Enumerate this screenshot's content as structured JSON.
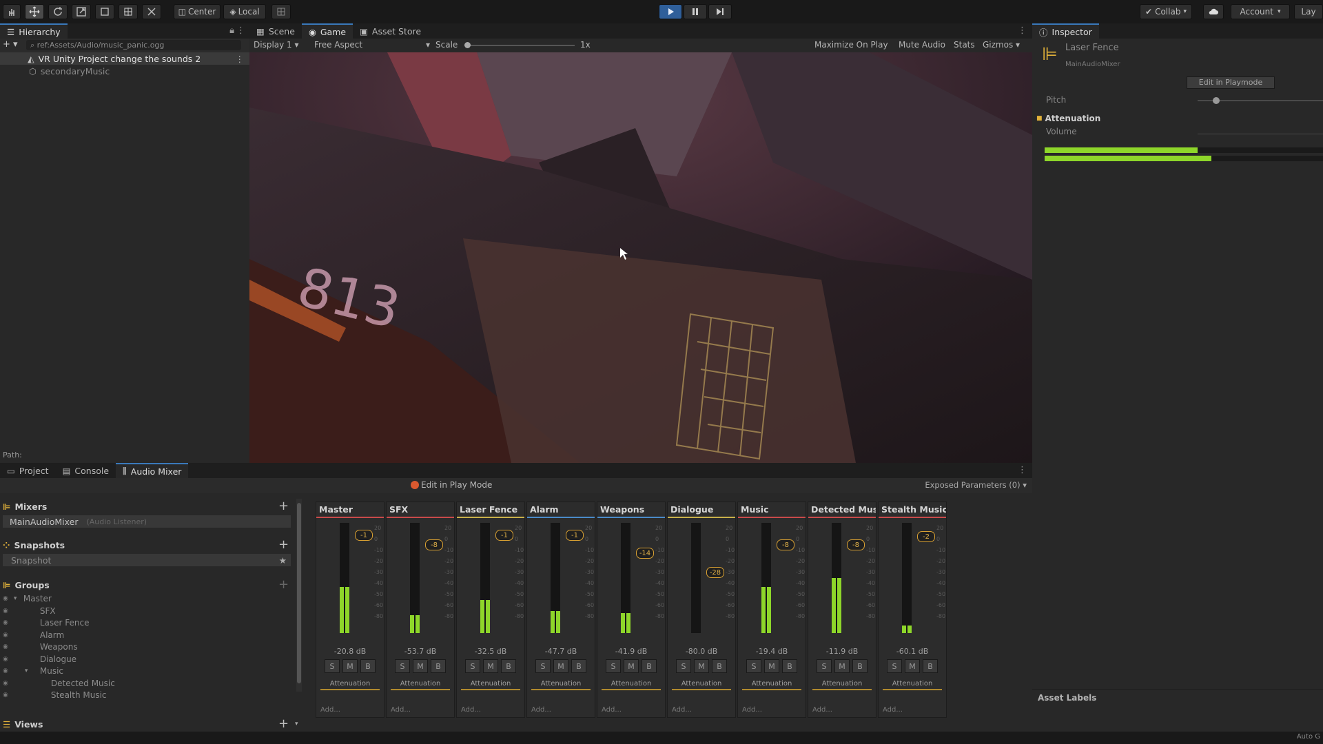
{
  "toolbar": {
    "pivot": "Center",
    "space": "Local",
    "collab": "Collab",
    "account": "Account",
    "layers": "Lay"
  },
  "hierarchy": {
    "tab": "Hierarchy",
    "search_path": "ref:Assets/Audio/music_panic.ogg",
    "scene_item": "VR Unity Project change the sounds 2",
    "child_item": "secondaryMusic",
    "path_label": "Path:"
  },
  "center_tabs": {
    "scene": "Scene",
    "game": "Game",
    "asset_store": "Asset Store"
  },
  "game_bar": {
    "display": "Display 1",
    "aspect": "Free Aspect",
    "scale_label": "Scale",
    "scale_value": "1x",
    "maximize": "Maximize On Play",
    "mute": "Mute Audio",
    "stats": "Stats",
    "gizmos": "Gizmos"
  },
  "inspector": {
    "tab": "Inspector",
    "object_name": "Laser Fence",
    "object_sub": "MainAudioMixer",
    "edit_button": "Edit in Playmode",
    "pitch_label": "Pitch",
    "attenuation_label": "Attenuation",
    "volume_label": "Volume",
    "asset_labels": "Asset Labels",
    "meter_levels": [
      0.55,
      0.6
    ]
  },
  "bottom_tabs": {
    "project": "Project",
    "console": "Console",
    "audio_mixer": "Audio Mixer"
  },
  "mixer_window": {
    "edit_play_mode": "Edit in Play Mode",
    "exposed_params": "Exposed Parameters (0)",
    "mixers_title": "Mixers",
    "mixer_name": "MainAudioMixer",
    "mixer_sub": "(Audio Listener)",
    "snapshots_title": "Snapshots",
    "snapshot_name": "Snapshot",
    "groups_title": "Groups",
    "groups": [
      "Master",
      "SFX",
      "Laser Fence",
      "Alarm",
      "Weapons",
      "Dialogue",
      "Music",
      "Detected Music",
      "Stealth Music"
    ],
    "views_title": "Views"
  },
  "strips": [
    {
      "name": "Master",
      "db": "-20.8 dB",
      "knob": "-1",
      "level": 0.42,
      "color": "#c94a4a"
    },
    {
      "name": "SFX",
      "db": "-53.7 dB",
      "knob": "-8",
      "level": 0.16,
      "color": "#c94a4a"
    },
    {
      "name": "Laser Fence",
      "db": "-32.5 dB",
      "knob": "-1",
      "level": 0.3,
      "color": "#c9b04a"
    },
    {
      "name": "Alarm",
      "db": "-47.7 dB",
      "knob": "-1",
      "level": 0.2,
      "color": "#4a8ac9"
    },
    {
      "name": "Weapons",
      "db": "-41.9 dB",
      "knob": "-14",
      "level": 0.18,
      "color": "#4a8ac9"
    },
    {
      "name": "Dialogue",
      "db": "-80.0 dB",
      "knob": "-28",
      "level": 0.0,
      "color": "#c9b04a"
    },
    {
      "name": "Music",
      "db": "-19.4 dB",
      "knob": "-8",
      "level": 0.42,
      "color": "#c94a4a"
    },
    {
      "name": "Detected Mus",
      "db": "-11.9 dB",
      "knob": "-8",
      "level": 0.5,
      "color": "#c94a4a"
    },
    {
      "name": "Stealth Music",
      "db": "-60.1 dB",
      "knob": "-2",
      "level": 0.07,
      "color": "#c94a4a"
    }
  ],
  "strip_labels": {
    "attenuation": "Attenuation",
    "add": "Add...",
    "s": "S",
    "m": "M",
    "b": "B"
  },
  "scale_ticks": [
    "20",
    "0",
    "-10",
    "-20",
    "-30",
    "-40",
    "-50",
    "-60",
    "-80"
  ],
  "game_view": {
    "number": "813"
  },
  "status": "Auto G"
}
